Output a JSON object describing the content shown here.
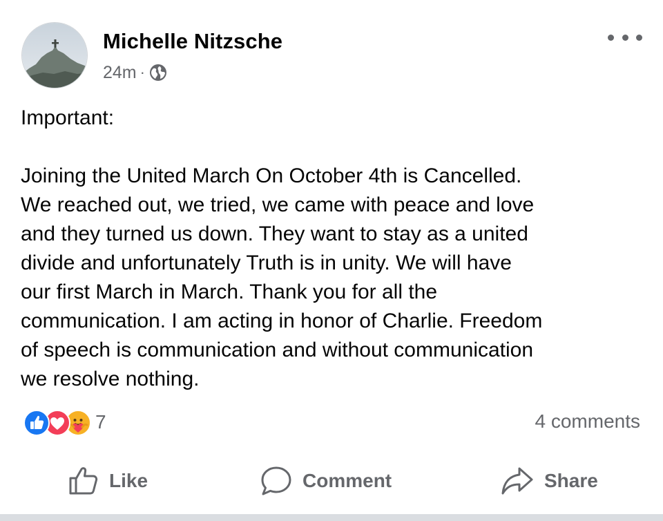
{
  "post": {
    "author": "Michelle Nitzsche",
    "timestamp": "24m",
    "separator": "·",
    "privacy_icon": "globe-icon",
    "more_icon": "more-options-icon",
    "text_lead": "Important:",
    "text_body": "Joining the United March On October 4th is Cancelled.\nWe reached out, we tried, we came with peace and love\nand they turned us down. They want to stay as a united\ndivide and unfortunately Truth is in unity. We will have\nour first March in March. Thank you for all the\ncommunication. I am acting in honor of Charlie. Freedom\nof speech is communication and without communication\nwe resolve nothing.",
    "reactions": {
      "icons": [
        "like-reaction-icon",
        "love-reaction-icon",
        "care-reaction-icon"
      ],
      "count": "7"
    },
    "comments_count": "4 comments"
  },
  "actions": {
    "like_label": "Like",
    "comment_label": "Comment",
    "share_label": "Share"
  },
  "colors": {
    "like_blue": "#1877f2",
    "love_red": "#f33e58",
    "care_yellow": "#f7b125",
    "secondary_text": "#65676b"
  }
}
